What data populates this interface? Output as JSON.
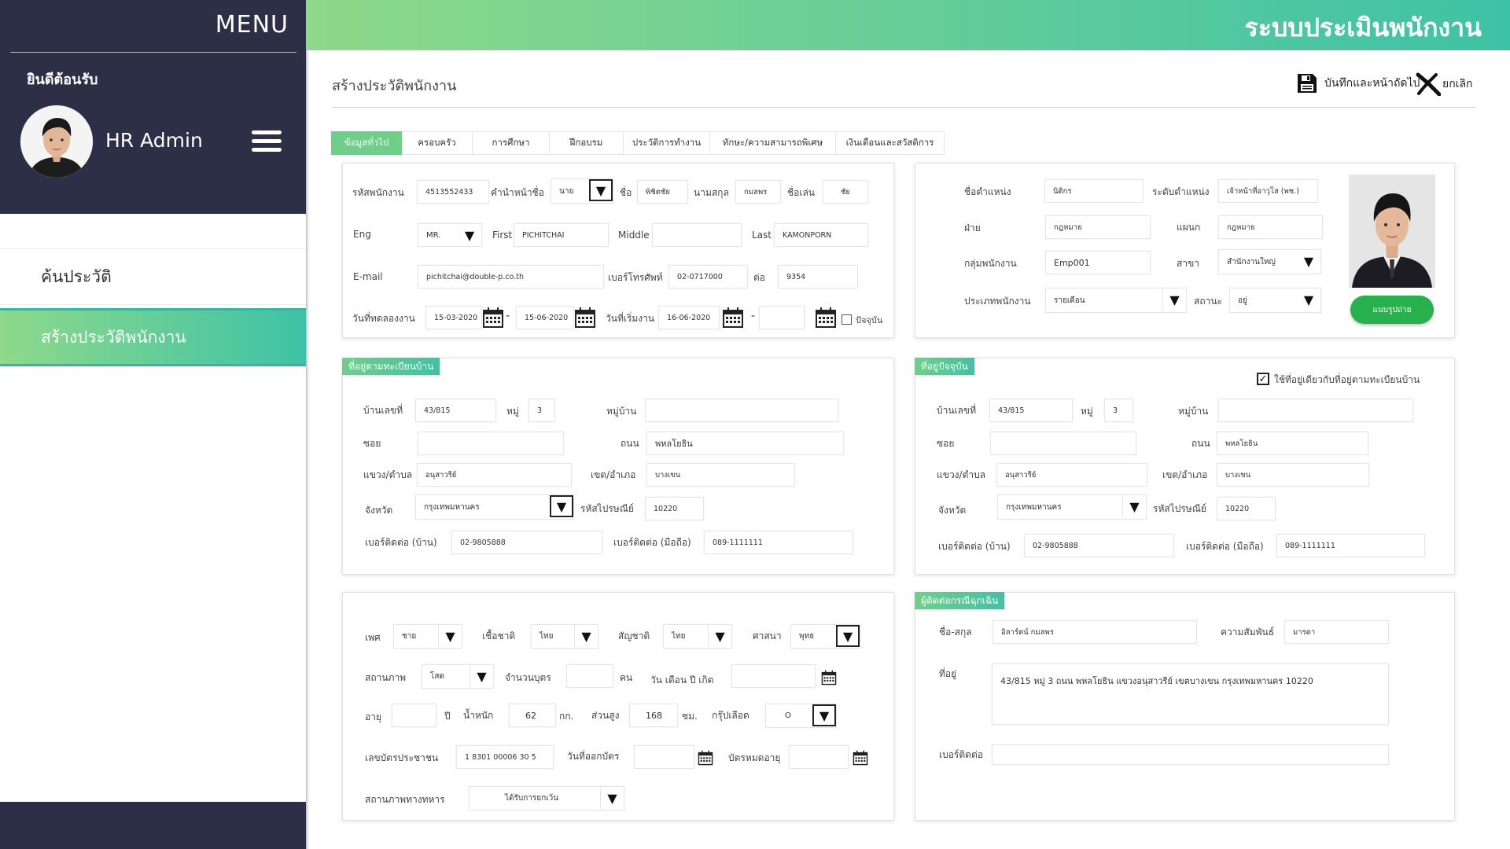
{
  "sidebar": {
    "menu_label": "MENU",
    "welcome": "ยินดีต้อนรับ",
    "user_name": "HR Admin",
    "items": [
      {
        "label": "ค้นประวัติ"
      },
      {
        "label": "สร้างประวัติพนักงาน"
      }
    ]
  },
  "header": {
    "system_title": "ระบบประเมินพนักงาน",
    "page_title": "สร้างประวัติพนักงาน",
    "save_label": "บันทึกและหน้าถัดไป",
    "cancel_label": "ยกเลิก"
  },
  "tabs": [
    {
      "label": "ข้อมูลทั่วไป",
      "active": true
    },
    {
      "label": "ครอบครัว"
    },
    {
      "label": "การศึกษา"
    },
    {
      "label": "ฝึกอบรม"
    },
    {
      "label": "ประวัติการทำงาน"
    },
    {
      "label": "ทักษะ/ความสามารถพิเศษ"
    },
    {
      "label": "เงินเดือนและสวัสดิการ"
    }
  ],
  "general": {
    "emp_id_label": "รหัสพนักงาน",
    "emp_id": "4513552433",
    "prefix_label": "คำนำหน้าชื่อ",
    "prefix": "นาย",
    "fname_label": "ชื่อ",
    "fname": "พิชิตชัย",
    "lname_label": "นามสกุล",
    "lname": "กมลพร",
    "nick_label": "ชื่อเล่น",
    "nick": "ชัย",
    "eng_label": "Eng",
    "eng_prefix": "MR.",
    "first_label": "First",
    "first": "PICHITCHAI",
    "middle_label": "Middle",
    "middle": "",
    "last_label": "Last",
    "last": "KAMONPORN",
    "email_label": "E-mail",
    "email": "pichitchai@double-p.co.th",
    "phone_label": "เบอร์โทรศัพท์",
    "phone": "02-0717000",
    "ext_label": "ต่อ",
    "ext": "9354",
    "trial_label": "วันที่ทดลองงาน",
    "trial_start": "15-03-2020",
    "trial_end": "15-06-2020",
    "start_label": "วันที่เริ่มงาน",
    "start_date": "16-06-2020",
    "end_date": "",
    "current_label": "ปัจจุบัน"
  },
  "position": {
    "title_label": "ชื่อตำแหน่ง",
    "title": "นิติกร",
    "level_label": "ระดับตำแหน่ง",
    "level": "เจ้าหน้าที่อาวุโส (พช.)",
    "division_label": "ฝ่าย",
    "division": "กฎหมาย",
    "dept_label": "แผนก",
    "dept": "กฎหมาย",
    "group_label": "กลุ่มพนักงาน",
    "group": "Emp001",
    "branch_label": "สาขา",
    "branch": "สำนักงานใหญ่",
    "type_label": "ประเภทพนักงาน",
    "type": "รายเดือน",
    "status_label": "สถานะ",
    "status": "อยู่",
    "upload_label": "แนบรูปถ่าย"
  },
  "reg_address": {
    "tag": "ที่อยู่ตามทะเบียนบ้าน",
    "house_label": "บ้านเลขที่",
    "house": "43/815",
    "moo_label": "หมู่",
    "moo": "3",
    "village_label": "หมู่บ้าน",
    "village": "",
    "soi_label": "ซอย",
    "soi": "",
    "road_label": "ถนน",
    "road": "พหลโยธิน",
    "subdistrict_label": "แขวง/ตำบล",
    "subdistrict": "อนุสาวรีย์",
    "district_label": "เขต/อำเภอ",
    "district": "บางเขน",
    "province_label": "จังหวัด",
    "province": "กรุงเทพมหานคร",
    "zip_label": "รหัสไปรษณีย์",
    "zip": "10220",
    "home_phone_label": "เบอร์ติดต่อ (บ้าน)",
    "home_phone": "02-9805888",
    "mobile_label": "เบอร์ติดต่อ (มือถือ)",
    "mobile": "089-1111111"
  },
  "cur_address": {
    "tag": "ที่อยู่ปัจจุบัน",
    "same_label": "ใช้ที่อยู่เดียวกับที่อยู่ตามทะเบียนบ้าน",
    "house_label": "บ้านเลขที่",
    "house": "43/815",
    "moo_label": "หมู่",
    "moo": "3",
    "village_label": "หมู่บ้าน",
    "village": "",
    "soi_label": "ซอย",
    "soi": "",
    "road_label": "ถนน",
    "road": "พหลโยธิน",
    "subdistrict_label": "แขวง/ตำบล",
    "subdistrict": "อนุสาวรีย์",
    "district_label": "เขต/อำเภอ",
    "district": "บางเขน",
    "province_label": "จังหวัด",
    "province": "กรุงเทพมหานคร",
    "zip_label": "รหัสไปรษณีย์",
    "zip": "10220",
    "home_phone_label": "เบอร์ติดต่อ (บ้าน)",
    "home_phone": "02-9805888",
    "mobile_label": "เบอร์ติดต่อ (มือถือ)",
    "mobile": "089-1111111"
  },
  "personal": {
    "sex_label": "เพศ",
    "sex": "ชาย",
    "race_label": "เชื้อชาติ",
    "race": "ไทย",
    "nationality_label": "สัญชาติ",
    "nationality": "ไทย",
    "religion_label": "ศาสนา",
    "religion": "พุทธ",
    "marital_label": "สถานภาพ",
    "marital": "โสด",
    "children_label": "จำนวนบุตร",
    "children": "",
    "children_unit": "คน",
    "dob_label": "วัน เดือน ปี เกิด",
    "dob": "",
    "age_label": "อายุ",
    "age": "",
    "age_unit": "ปี",
    "weight_label": "น้ำหนัก",
    "weight": "62",
    "weight_unit": "กก.",
    "height_label": "ส่วนสูง",
    "height": "168",
    "height_unit": "ซม.",
    "blood_label": "กรุ๊ปเลือด",
    "blood": "O",
    "id_label": "เลขบัตรประชาชน",
    "id_no": "1 8301 00006 30 5",
    "issue_label": "วันที่ออกบัตร",
    "issue": "",
    "expire_label": "บัตรหมดอายุ",
    "expire": "",
    "military_label": "สถานภาพทางทหาร",
    "military": "ได้รับการยกเว้น"
  },
  "emergency": {
    "tag": "ผู้ติดต่อกรณีฉุกเฉิน",
    "name_label": "ชื่อ-สกุล",
    "name": "อิลาร์ตน์ กมลพร",
    "relation_label": "ความสัมพันธ์",
    "relation": "มารดา",
    "address_label": "ที่อยู่",
    "address": "43/815 หมู่ 3 ถนน พหลโยธิน แขวงอนุสาวรีย์ เขตบางเขน กรุงเทพมหานคร 10220",
    "phone_label": "เบอร์ติดต่อ",
    "phone": ""
  }
}
